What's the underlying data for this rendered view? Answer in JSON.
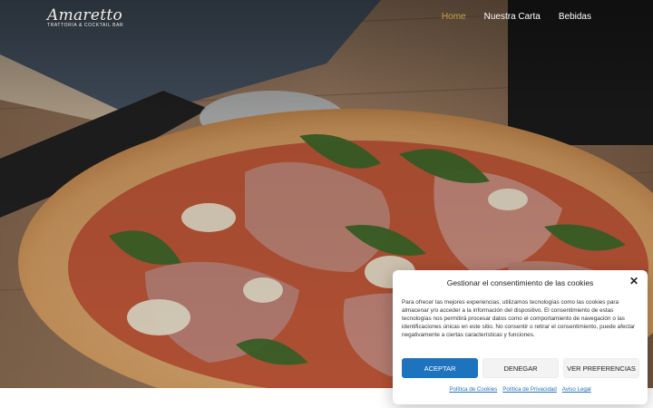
{
  "logo": {
    "script_text": "Amaretto",
    "subtitle": "TRATTORIA & COCKTAIL BAR"
  },
  "nav": {
    "items": [
      {
        "label": "Home",
        "active": true
      },
      {
        "label": "Nuestra Carta",
        "active": false
      },
      {
        "label": "Bebidas",
        "active": false
      }
    ]
  },
  "colors": {
    "accent_gold": "#c9a24a",
    "button_primary": "#1e73be",
    "link": "#1e73be"
  },
  "cookie_dialog": {
    "title": "Gestionar el consentimiento de las cookies",
    "close_icon": "close-icon",
    "body": "Para ofrecer las mejores experiencias, utilizamos tecnologías como las cookies para almacenar y/o acceder a la información del dispositivo. El consentimiento de estas tecnologías nos permitirá procesar datos como el comportamiento de navegación o las identificaciones únicas en este sitio. No consentir o retirar el consentimiento, puede afectar negativamente a ciertas características y funciones.",
    "buttons": {
      "accept": "ACEPTAR",
      "deny": "DENEGAR",
      "preferences": "VER PREFERENCIAS"
    },
    "links": {
      "cookies": "Política de Cookies",
      "privacy": "Política de Privacidad",
      "legal": "Aviso Legal"
    }
  }
}
